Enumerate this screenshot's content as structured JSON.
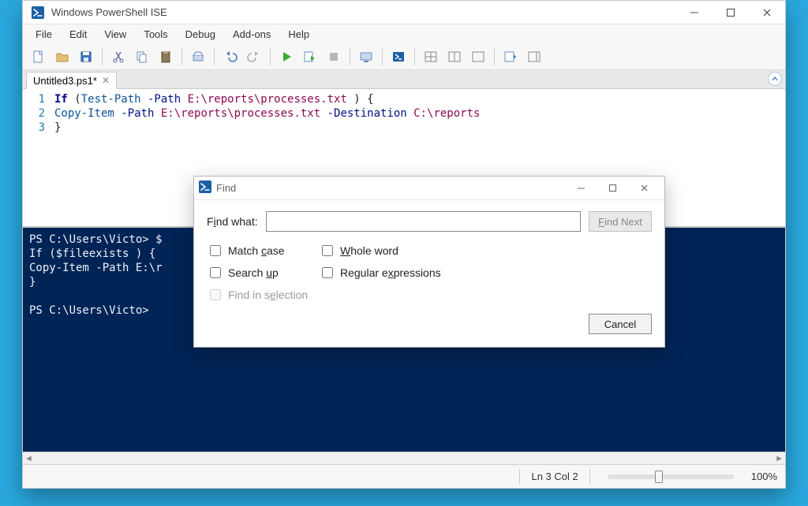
{
  "window": {
    "title": "Windows PowerShell ISE",
    "controls": {
      "min": "–",
      "max": "▢",
      "close": "✕"
    }
  },
  "menu": [
    "File",
    "Edit",
    "View",
    "Tools",
    "Debug",
    "Add-ons",
    "Help"
  ],
  "tabs": [
    {
      "label": "Untitled3.ps1*"
    }
  ],
  "editor": {
    "line_numbers": [
      "1",
      "2",
      "3"
    ],
    "line1": {
      "kw": "If",
      "open": " (",
      "cmd": "Test-Path",
      "p1": " -Path",
      "str": " E:\\reports\\processes.txt",
      "close": " ) {"
    },
    "line2": {
      "cmd": "Copy-Item",
      "p1": " -Path",
      "str1": " E:\\reports\\processes.txt",
      "p2": " -Destination",
      "str2": " C:\\reports"
    },
    "line3": {
      "close": "}"
    }
  },
  "console_text": "PS C:\\Users\\Victo> $\nIf ($fileexists ) {\nCopy-Item -Path E:\\r\n}\n\nPS C:\\Users\\Victo>",
  "status": {
    "position": "Ln 3  Col 2",
    "zoom": "100%"
  },
  "find": {
    "title": "Find",
    "label_full": "Find what:",
    "label_pre": "F",
    "label_u": "i",
    "label_post": "nd what:",
    "find_next_pre": "",
    "find_next_u": "F",
    "find_next_post": "ind Next",
    "match_case_pre": "Match ",
    "match_case_u": "c",
    "match_case_post": "ase",
    "whole_word_pre": "",
    "whole_word_u": "W",
    "whole_word_post": "hole word",
    "search_up_pre": "Search ",
    "search_up_u": "u",
    "search_up_post": "p",
    "regex_pre": "Regular e",
    "regex_u": "x",
    "regex_post": "pressions",
    "selection_pre": "Find in s",
    "selection_u": "e",
    "selection_post": "lection",
    "cancel": "Cancel"
  }
}
